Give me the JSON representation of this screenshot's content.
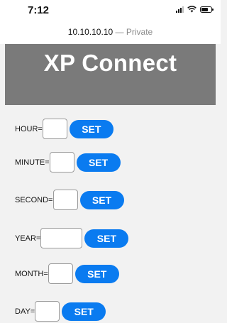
{
  "status_bar": {
    "time": "7:12"
  },
  "browser": {
    "host": "10.10.10.10",
    "separator": "—",
    "mode": "Private"
  },
  "page": {
    "title": "XP Connect",
    "rows": [
      {
        "label": "HOUR=",
        "value": "",
        "button": "SET"
      },
      {
        "label": "MINUTE=",
        "value": "",
        "button": "SET"
      },
      {
        "label": "SECOND=",
        "value": "",
        "button": "SET"
      },
      {
        "label": "YEAR=",
        "value": "",
        "button": "SET"
      },
      {
        "label": "MONTH=",
        "value": "",
        "button": "SET"
      },
      {
        "label": "DAY=",
        "value": "",
        "button": "SET"
      }
    ]
  },
  "colors": {
    "header_bg": "#7a7a7a",
    "button_bg": "#0a7bf0",
    "page_bg": "#f2f2f2"
  }
}
